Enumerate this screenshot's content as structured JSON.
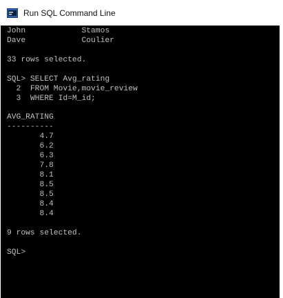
{
  "window": {
    "title": "Run SQL Command Line",
    "icon": "sql-console-icon"
  },
  "console": {
    "lines": [
      "John            Stamos",
      "Dave            Coulier",
      "",
      "33 rows selected.",
      "",
      "SQL> SELECT Avg_rating",
      "  2  FROM Movie,movie_review",
      "  3  WHERE Id=M_id;",
      "",
      "AVG_RATING",
      "----------",
      "       4.7",
      "       6.2",
      "       6.3",
      "       7.8",
      "       8.1",
      "       8.5",
      "       8.5",
      "       8.4",
      "       8.4",
      "",
      "9 rows selected.",
      "",
      "SQL> "
    ]
  },
  "colors": {
    "console_bg": "#000000",
    "console_text": "#c0c0c0",
    "titlebar_bg": "#ffffff"
  }
}
